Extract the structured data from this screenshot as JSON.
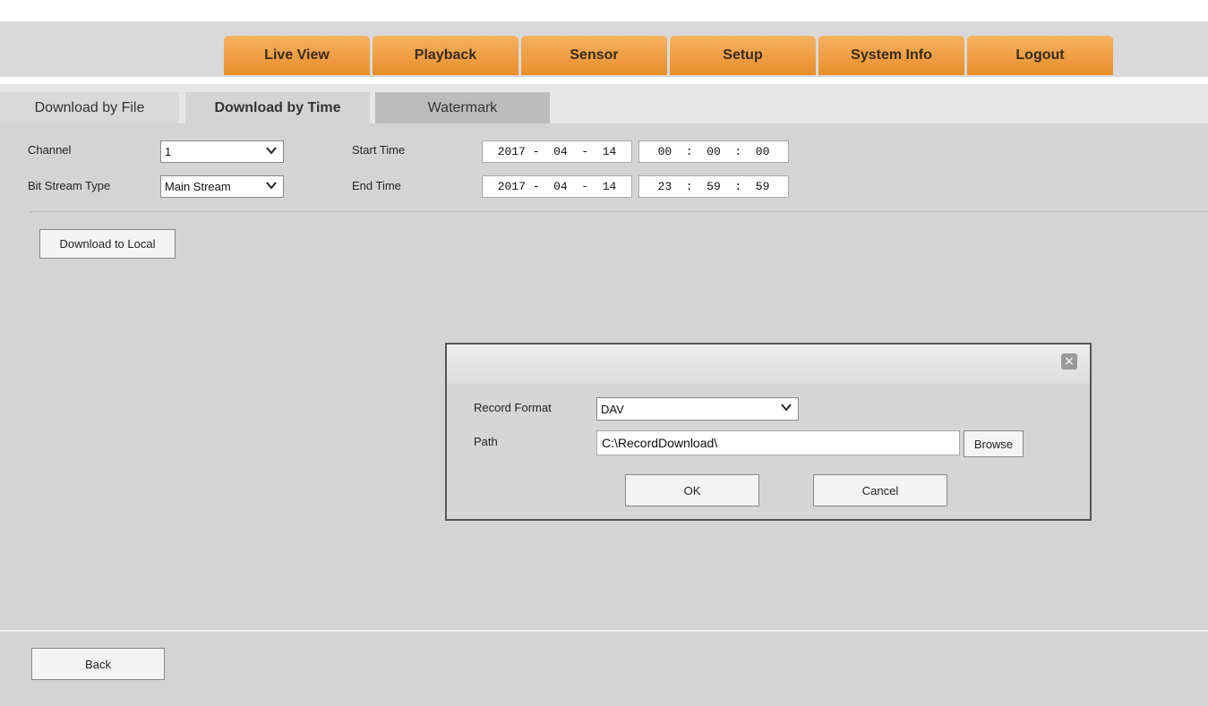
{
  "nav": {
    "tabs": [
      "Live View",
      "Playback",
      "Sensor",
      "Setup",
      "System Info",
      "Logout"
    ]
  },
  "subtabs": {
    "file": "Download by File",
    "time": "Download by Time",
    "watermark": "Watermark"
  },
  "form": {
    "channel_label": "Channel",
    "channel_value": "1",
    "bitstream_label": "Bit Stream Type",
    "bitstream_value": "Main Stream",
    "start_label": "Start Time",
    "start_date": "2017 -  04  -  14",
    "start_time": "00  :  00  :  00",
    "end_label": "End Time",
    "end_date": "2017 -  04  -  14",
    "end_time": "23  :  59  :  59"
  },
  "buttons": {
    "download": "Download to Local",
    "back": "Back"
  },
  "dialog": {
    "format_label": "Record Format",
    "format_value": "DAV",
    "path_label": "Path",
    "path_value": "C:\\RecordDownload\\",
    "browse": "Browse",
    "ok": "OK",
    "cancel": "Cancel",
    "close_glyph": "×"
  },
  "colors": {
    "tab_orange": "#e98e2a",
    "page_gray": "#d4d4d4"
  }
}
